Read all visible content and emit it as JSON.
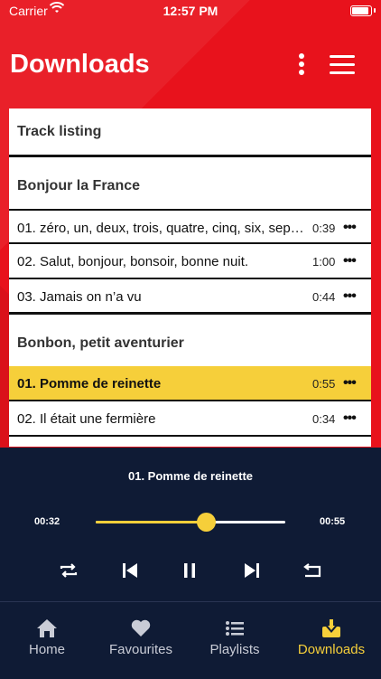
{
  "status_bar": {
    "carrier": "Carrier",
    "time": "12:57 PM"
  },
  "header": {
    "title": "Downloads"
  },
  "track_listing": {
    "heading": "Track listing"
  },
  "albums": [
    {
      "title": "Bonjour la France",
      "tracks": [
        {
          "title": "01. zéro, un, deux, trois, quatre, cinq, six, sep…",
          "duration": "0:39",
          "more": "•••"
        },
        {
          "title": "02. Salut, bonjour, bonsoir, bonne nuit.",
          "duration": "1:00",
          "more": "•••"
        },
        {
          "title": "03. Jamais on n’a vu",
          "duration": "0:44",
          "more": "•••"
        }
      ]
    },
    {
      "title": "Bonbon, petit aventurier",
      "tracks": [
        {
          "title": "01. Pomme de reinette",
          "duration": "0:55",
          "more": "•••"
        },
        {
          "title": "02. Il était une fermière",
          "duration": "0:34",
          "more": "•••"
        }
      ]
    }
  ],
  "player": {
    "now_playing": "01. Pomme de reinette",
    "elapsed": "00:32",
    "total": "00:55",
    "progress_fraction": 0.58
  },
  "tabs": [
    {
      "label": "Home",
      "icon": "home-icon"
    },
    {
      "label": "Favourites",
      "icon": "heart-icon"
    },
    {
      "label": "Playlists",
      "icon": "list-icon"
    },
    {
      "label": "Downloads",
      "icon": "download-icon"
    }
  ],
  "colors": {
    "brand_red": "#e8121c",
    "accent_yellow": "#f6cf3a",
    "navy": "#0f1b35"
  }
}
